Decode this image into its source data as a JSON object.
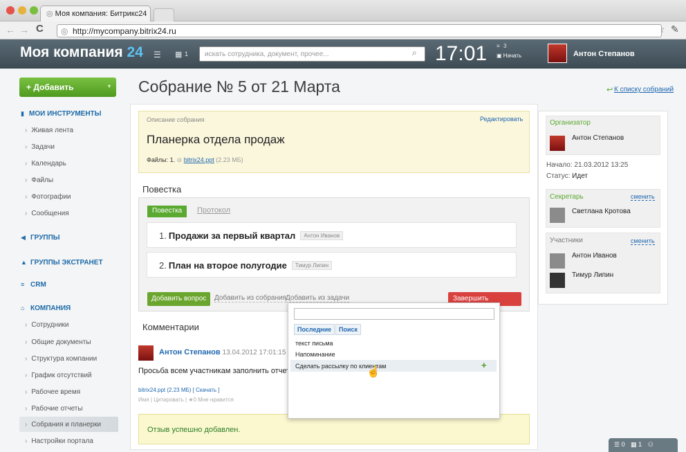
{
  "browser": {
    "tab_title": "Моя компания: Битрикс24",
    "url": "http://mycompany.bitrix24.ru"
  },
  "header": {
    "logo_name": "Моя компания",
    "logo_number": "24",
    "notifications_count": "1",
    "search_placeholder": "искать сотрудника, документ, прочее...",
    "clock": "17:01",
    "tasks_count": "3",
    "start_label": "Начать",
    "user_name": "Антон Степанов"
  },
  "sidebar": {
    "add_button": "+ Добавить",
    "sections": {
      "tools": "МОИ ИНСТРУМЕНТЫ",
      "groups": "ГРУППЫ",
      "extranet": "ГРУППЫ ЭКСТРАНЕТ",
      "crm": "CRM",
      "company": "КОМПАНИЯ"
    },
    "tools_items": [
      "Живая лента",
      "Задачи",
      "Календарь",
      "Файлы",
      "Фотографии",
      "Сообщения"
    ],
    "company_items": [
      "Сотрудники",
      "Общие документы",
      "Структура компании",
      "График отсутствий",
      "Рабочее время",
      "Рабочие отчеты",
      "Собрания и планерки",
      "Настройки портала"
    ]
  },
  "main": {
    "title": "Собрание № 5 от 21 Марта",
    "back_link": "К списку собраний",
    "description": {
      "label": "Описание собрания",
      "edit": "Редактировать",
      "title": "Планерка отдела продаж",
      "files_label": "Файлы:",
      "files_index": "1.",
      "file_name": "bitrix24.ppt",
      "file_size": "(2.23 МБ)"
    },
    "agenda": {
      "heading": "Повестка",
      "tabs": [
        "Повестка",
        "Протокол"
      ],
      "items": [
        {
          "num": "1.",
          "text": "Продажи за первый квартал",
          "owner": "Антон Иванов"
        },
        {
          "num": "2.",
          "text": "План на второе полугодие",
          "owner": "Тимур Липин"
        }
      ],
      "add_question": "Добавить вопрос",
      "add_from_meeting": "Добавить из собрания",
      "add_from_task": "Добавить из задачи",
      "finish": "Завершить собрание"
    },
    "comments": {
      "heading": "Комментарии",
      "author": "Антон Степанов",
      "date": "13.04.2012 17:01:15",
      "text": "Просьба всем участникам заполнить отчеты",
      "file": "bitrix24.ppt (2.23 МБ) [",
      "download": "Скачать",
      "file_end": "]",
      "meta": "Имя | Цитировать | ★0 Мне нравится"
    },
    "success": "Отзыв успешно добавлен."
  },
  "popup": {
    "tabs": [
      "Последние",
      "Поиск"
    ],
    "items": [
      "текст письма",
      "Напоминание",
      "Сделать рассылку по клиентам"
    ]
  },
  "right": {
    "organizer_title": "Организатор",
    "organizer": "Антон Степанов",
    "start": "Начало: 21.03.2012 13:25",
    "status_label": "Статус:",
    "status": "Идет",
    "secretary_title": "Секретарь",
    "change": "сменить",
    "secretary": "Светлана Кротова",
    "participants_title": "Участники",
    "participants": [
      "Антон Иванов",
      "Тимур Липин"
    ]
  },
  "bottom_bar": {
    "messages": "0",
    "notifications": "1"
  },
  "colors": {
    "accent_green": "#5aa930",
    "link_blue": "#2067b0",
    "danger_red": "#d9413f"
  }
}
